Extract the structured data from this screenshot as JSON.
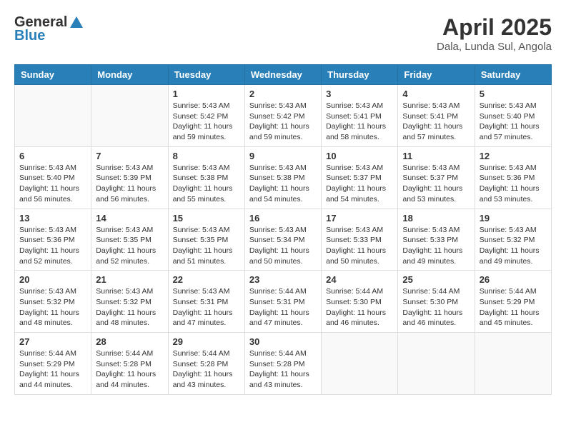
{
  "header": {
    "logo_general": "General",
    "logo_blue": "Blue",
    "month_year": "April 2025",
    "location": "Dala, Lunda Sul, Angola"
  },
  "calendar": {
    "days_of_week": [
      "Sunday",
      "Monday",
      "Tuesday",
      "Wednesday",
      "Thursday",
      "Friday",
      "Saturday"
    ],
    "weeks": [
      [
        {
          "day": "",
          "detail": ""
        },
        {
          "day": "",
          "detail": ""
        },
        {
          "day": "1",
          "detail": "Sunrise: 5:43 AM\nSunset: 5:42 PM\nDaylight: 11 hours and 59 minutes."
        },
        {
          "day": "2",
          "detail": "Sunrise: 5:43 AM\nSunset: 5:42 PM\nDaylight: 11 hours and 59 minutes."
        },
        {
          "day": "3",
          "detail": "Sunrise: 5:43 AM\nSunset: 5:41 PM\nDaylight: 11 hours and 58 minutes."
        },
        {
          "day": "4",
          "detail": "Sunrise: 5:43 AM\nSunset: 5:41 PM\nDaylight: 11 hours and 57 minutes."
        },
        {
          "day": "5",
          "detail": "Sunrise: 5:43 AM\nSunset: 5:40 PM\nDaylight: 11 hours and 57 minutes."
        }
      ],
      [
        {
          "day": "6",
          "detail": "Sunrise: 5:43 AM\nSunset: 5:40 PM\nDaylight: 11 hours and 56 minutes."
        },
        {
          "day": "7",
          "detail": "Sunrise: 5:43 AM\nSunset: 5:39 PM\nDaylight: 11 hours and 56 minutes."
        },
        {
          "day": "8",
          "detail": "Sunrise: 5:43 AM\nSunset: 5:38 PM\nDaylight: 11 hours and 55 minutes."
        },
        {
          "day": "9",
          "detail": "Sunrise: 5:43 AM\nSunset: 5:38 PM\nDaylight: 11 hours and 54 minutes."
        },
        {
          "day": "10",
          "detail": "Sunrise: 5:43 AM\nSunset: 5:37 PM\nDaylight: 11 hours and 54 minutes."
        },
        {
          "day": "11",
          "detail": "Sunrise: 5:43 AM\nSunset: 5:37 PM\nDaylight: 11 hours and 53 minutes."
        },
        {
          "day": "12",
          "detail": "Sunrise: 5:43 AM\nSunset: 5:36 PM\nDaylight: 11 hours and 53 minutes."
        }
      ],
      [
        {
          "day": "13",
          "detail": "Sunrise: 5:43 AM\nSunset: 5:36 PM\nDaylight: 11 hours and 52 minutes."
        },
        {
          "day": "14",
          "detail": "Sunrise: 5:43 AM\nSunset: 5:35 PM\nDaylight: 11 hours and 52 minutes."
        },
        {
          "day": "15",
          "detail": "Sunrise: 5:43 AM\nSunset: 5:35 PM\nDaylight: 11 hours and 51 minutes."
        },
        {
          "day": "16",
          "detail": "Sunrise: 5:43 AM\nSunset: 5:34 PM\nDaylight: 11 hours and 50 minutes."
        },
        {
          "day": "17",
          "detail": "Sunrise: 5:43 AM\nSunset: 5:33 PM\nDaylight: 11 hours and 50 minutes."
        },
        {
          "day": "18",
          "detail": "Sunrise: 5:43 AM\nSunset: 5:33 PM\nDaylight: 11 hours and 49 minutes."
        },
        {
          "day": "19",
          "detail": "Sunrise: 5:43 AM\nSunset: 5:32 PM\nDaylight: 11 hours and 49 minutes."
        }
      ],
      [
        {
          "day": "20",
          "detail": "Sunrise: 5:43 AM\nSunset: 5:32 PM\nDaylight: 11 hours and 48 minutes."
        },
        {
          "day": "21",
          "detail": "Sunrise: 5:43 AM\nSunset: 5:32 PM\nDaylight: 11 hours and 48 minutes."
        },
        {
          "day": "22",
          "detail": "Sunrise: 5:43 AM\nSunset: 5:31 PM\nDaylight: 11 hours and 47 minutes."
        },
        {
          "day": "23",
          "detail": "Sunrise: 5:44 AM\nSunset: 5:31 PM\nDaylight: 11 hours and 47 minutes."
        },
        {
          "day": "24",
          "detail": "Sunrise: 5:44 AM\nSunset: 5:30 PM\nDaylight: 11 hours and 46 minutes."
        },
        {
          "day": "25",
          "detail": "Sunrise: 5:44 AM\nSunset: 5:30 PM\nDaylight: 11 hours and 46 minutes."
        },
        {
          "day": "26",
          "detail": "Sunrise: 5:44 AM\nSunset: 5:29 PM\nDaylight: 11 hours and 45 minutes."
        }
      ],
      [
        {
          "day": "27",
          "detail": "Sunrise: 5:44 AM\nSunset: 5:29 PM\nDaylight: 11 hours and 44 minutes."
        },
        {
          "day": "28",
          "detail": "Sunrise: 5:44 AM\nSunset: 5:28 PM\nDaylight: 11 hours and 44 minutes."
        },
        {
          "day": "29",
          "detail": "Sunrise: 5:44 AM\nSunset: 5:28 PM\nDaylight: 11 hours and 43 minutes."
        },
        {
          "day": "30",
          "detail": "Sunrise: 5:44 AM\nSunset: 5:28 PM\nDaylight: 11 hours and 43 minutes."
        },
        {
          "day": "",
          "detail": ""
        },
        {
          "day": "",
          "detail": ""
        },
        {
          "day": "",
          "detail": ""
        }
      ]
    ]
  }
}
